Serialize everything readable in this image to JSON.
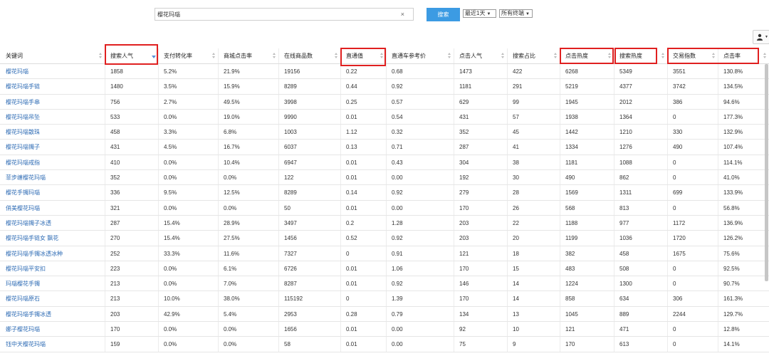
{
  "search": {
    "value": "樱花玛瑙",
    "clear_icon": "×",
    "button_label": "搜索"
  },
  "filters": {
    "period": "最近1天",
    "terminal": "所有终端",
    "caret": "▼"
  },
  "export_icon": "person-export-icon",
  "table": {
    "columns": [
      "关键词",
      "搜索人气",
      "支付转化率",
      "商城点击率",
      "在线商品数",
      "直通值",
      "直通车参考价",
      "点击人气",
      "搜索占比",
      "点击热度",
      "搜索热度",
      "交易指数",
      "点击率"
    ],
    "rows": [
      [
        "樱花玛瑙",
        "1858",
        "5.2%",
        "21.9%",
        "19156",
        "0.22",
        "0.68",
        "1473",
        "422",
        "6268",
        "5349",
        "3551",
        "130.8%"
      ],
      [
        "樱花玛瑙手链",
        "1480",
        "3.5%",
        "15.9%",
        "8289",
        "0.44",
        "0.92",
        "1181",
        "291",
        "5219",
        "4377",
        "3742",
        "134.5%"
      ],
      [
        "樱花玛瑙手串",
        "756",
        "2.7%",
        "49.5%",
        "3998",
        "0.25",
        "0.57",
        "629",
        "99",
        "1945",
        "2012",
        "386",
        "94.6%"
      ],
      [
        "樱花玛瑙吊坠",
        "533",
        "0.0%",
        "19.0%",
        "9990",
        "0.01",
        "0.54",
        "431",
        "57",
        "1938",
        "1364",
        "0",
        "177.3%"
      ],
      [
        "樱花玛瑙散珠",
        "458",
        "3.3%",
        "6.8%",
        "1003",
        "1.12",
        "0.32",
        "352",
        "45",
        "1442",
        "1210",
        "330",
        "132.9%"
      ],
      [
        "樱花玛瑙镯子",
        "431",
        "4.5%",
        "16.7%",
        "6037",
        "0.13",
        "0.71",
        "287",
        "41",
        "1334",
        "1276",
        "490",
        "107.4%"
      ],
      [
        "樱花玛瑙戒指",
        "410",
        "0.0%",
        "10.4%",
        "6947",
        "0.01",
        "0.43",
        "304",
        "38",
        "1181",
        "1088",
        "0",
        "114.1%"
      ],
      [
        "菲步缠樱花玛瑙",
        "352",
        "0.0%",
        "0.0%",
        "122",
        "0.01",
        "0.00",
        "192",
        "30",
        "490",
        "862",
        "0",
        "41.0%"
      ],
      [
        "樱花手镯玛瑙",
        "336",
        "9.5%",
        "12.5%",
        "8289",
        "0.14",
        "0.92",
        "279",
        "28",
        "1569",
        "1311",
        "699",
        "133.9%"
      ],
      [
        "俏美樱花玛瑙",
        "321",
        "0.0%",
        "0.0%",
        "50",
        "0.01",
        "0.00",
        "170",
        "26",
        "568",
        "813",
        "0",
        "56.8%"
      ],
      [
        "樱花玛瑙镯子冰透",
        "287",
        "15.4%",
        "28.9%",
        "3497",
        "0.2",
        "1.28",
        "203",
        "22",
        "1188",
        "977",
        "1172",
        "136.9%"
      ],
      [
        "樱花玛瑙手链女 飘花",
        "270",
        "15.4%",
        "27.5%",
        "1456",
        "0.52",
        "0.92",
        "203",
        "20",
        "1199",
        "1036",
        "1720",
        "126.2%"
      ],
      [
        "樱花玛瑙手镯冰透冰种",
        "252",
        "33.3%",
        "11.6%",
        "7327",
        "0",
        "0.91",
        "121",
        "18",
        "382",
        "458",
        "1675",
        "75.6%"
      ],
      [
        "樱花玛瑙平安扣",
        "223",
        "0.0%",
        "6.1%",
        "6726",
        "0.01",
        "1.06",
        "170",
        "15",
        "483",
        "508",
        "0",
        "92.5%"
      ],
      [
        "玛瑙樱花手镯",
        "213",
        "0.0%",
        "7.0%",
        "8287",
        "0.01",
        "0.92",
        "146",
        "14",
        "1224",
        "1300",
        "0",
        "90.7%"
      ],
      [
        "樱花玛瑙原石",
        "213",
        "10.0%",
        "38.0%",
        "115192",
        "0",
        "1.39",
        "170",
        "14",
        "858",
        "634",
        "306",
        "161.3%"
      ],
      [
        "樱花玛瑙手镯冰透",
        "203",
        "42.9%",
        "5.4%",
        "2953",
        "0.28",
        "0.79",
        "134",
        "13",
        "1045",
        "889",
        "2244",
        "129.7%"
      ],
      [
        "娜子樱花玛瑙",
        "170",
        "0.0%",
        "0.0%",
        "1656",
        "0.01",
        "0.00",
        "92",
        "10",
        "121",
        "471",
        "0",
        "12.8%"
      ],
      [
        "钰中天樱花玛瑙",
        "159",
        "0.0%",
        "0.0%",
        "58",
        "0.01",
        "0.00",
        "75",
        "9",
        "170",
        "613",
        "0",
        "14.1%"
      ]
    ]
  }
}
